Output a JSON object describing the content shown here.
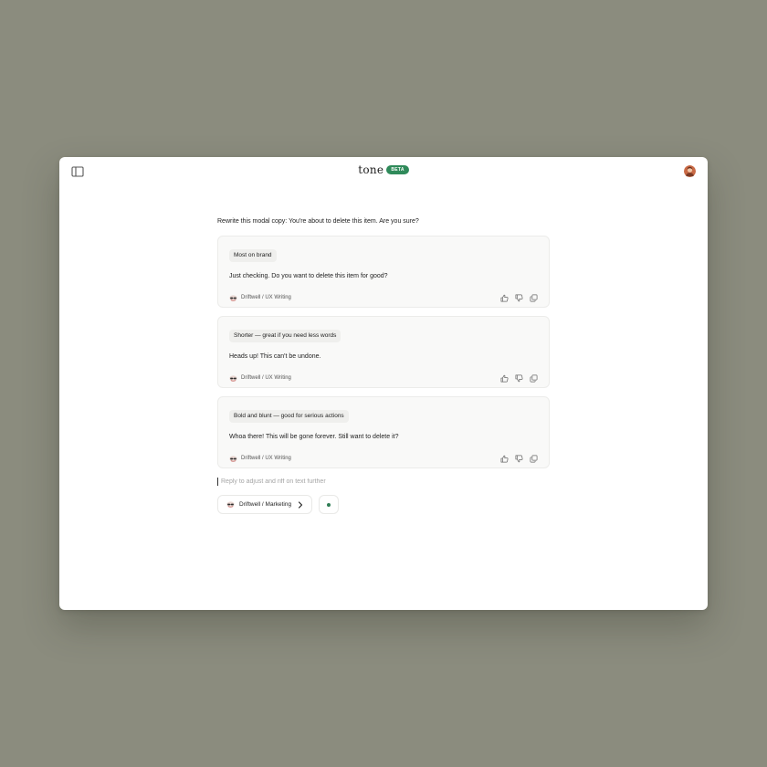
{
  "header": {
    "logo": "tone",
    "badge": "BETA"
  },
  "prompt": "Rewrite this modal copy: You're about to delete this item. Are you sure?",
  "suggestions": [
    {
      "label": "Most on brand",
      "text": "Just checking. Do you want to delete this item for good?",
      "source": "Driftwell / UX Writing"
    },
    {
      "label": "Shorter — great if you need less words",
      "text": "Heads up! This can't be undone.",
      "source": "Driftwell / UX Writing"
    },
    {
      "label": "Bold and blunt — good for serious actions",
      "text": "Whoa there! This will be gone forever. Still want to delete it?",
      "source": "Driftwell / UX Writing"
    }
  ],
  "reply": {
    "placeholder": "Reply to adjust and riff on text further",
    "value": ""
  },
  "profile_selector": {
    "label": "Driftwell / Marketing"
  },
  "icons": {
    "sidebar": "sidebar-toggle-icon",
    "thumbs_up": "thumbs-up-icon",
    "thumbs_down": "thumbs-down-icon",
    "copy": "copy-icon",
    "source": "brand-glasses-icon",
    "chevron": "chevron-right-icon"
  },
  "colors": {
    "background": "#8b8c7e",
    "accent": "#2f8a5a",
    "status_dot": "#2f7d55",
    "card": "#f9f9f8"
  }
}
